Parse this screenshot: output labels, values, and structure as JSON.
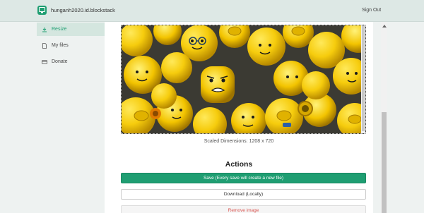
{
  "header": {
    "app_name": "hunganh2020.id.blockstack",
    "signout_label": "Sign Out"
  },
  "sidebar": {
    "items": [
      {
        "label": "Resize",
        "icon": "resize-icon",
        "active": true
      },
      {
        "label": "My files",
        "icon": "file-icon",
        "active": false
      },
      {
        "label": "Donate",
        "icon": "card-icon",
        "active": false
      }
    ]
  },
  "main": {
    "image_alt": "lego minifigure heads",
    "scaled_dimensions": "Scaled Dimensions: 1208 x 720",
    "actions_title": "Actions",
    "save_label": "Save (Every save will create a new file)",
    "download_label": "Download (Locally)",
    "remove_label": "Remove image"
  },
  "colors": {
    "accent": "#1f9e72",
    "danger": "#d9534f",
    "topbar": "#dde8e5"
  }
}
